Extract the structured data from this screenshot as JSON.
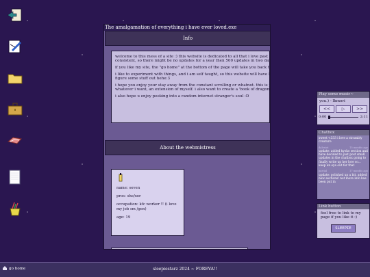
{
  "desktop": {
    "icons": [
      "arrow-scroll-icon",
      "edit-document-icon",
      "folder-icon",
      "briefcase-icon",
      "candy-icon",
      "notepad-icon",
      "paint-bucket-icon"
    ]
  },
  "main_window": {
    "title": "The amalgamation of everything i have ever loved.exe",
    "info_header": "Info",
    "info_paragraphs": [
      "welcome to this mess of a site :) this website is dedicated to all that i love past and present, i'll try to keep it consistent, so there might be no updates for a year then 500 updates in two days :)",
      "if you like my site, the \"go home\" at the bottom of the page will take you back to my homepage",
      "i like to experiment with things, and i am self taught, so this website will have HEAVY personal tweaks as i figure some stuff out hehe:3",
      "i hope you enjoy your stay away from the constant scrolling or whatnot. this is pure self expression, do whatever i want, an extension of myself. i also want to create a 'book of dragons' as i like dragons",
      "i also hope u enjoy peeking into a random internet stranger's soul :D"
    ],
    "about_header": "About the webmistress",
    "profile": {
      "name": "name: seven",
      "pronouns": "pros: she/xer",
      "occupation": "occupation: kfc worker !! (i love my job sm /gen)",
      "age": "age: 19"
    }
  },
  "music_player": {
    "title": "Play some music~",
    "song": "you.) - lkmori",
    "prev_label": "<<",
    "play_label": "▷",
    "next_label": ">>",
    "time_current": "0:00",
    "time_total": "2:11",
    "progress": 0
  },
  "chatbox": {
    "title": "Chatbox",
    "messages": [
      {
        "text": "sweet <333 i love a strumbly creature",
        "author": "",
        "time": ""
      },
      {
        "text": "update: added kyoko section and have decided to just post small updates in the chatbox going to finally write up her lore so... keep an eye out for that",
        "author": "dalesiot",
        "time": "15 months ago"
      },
      {
        "text": "update: polished up a bit, added new sections! not more info has been put in",
        "author": "partial",
        "time": "17 months ago"
      }
    ]
  },
  "link_box": {
    "title": "Link button",
    "text": "feel free to link to my page if you like it :)",
    "button_label": "SLEEPIE"
  },
  "footer": {
    "go_home": "go home",
    "text": "sleepiestarz 2024 ~ FOREVA!!"
  },
  "colors": {
    "background": "#2a1650",
    "window": "#6b5a93",
    "panel": "#c8bfe0",
    "header": "#3e3258"
  }
}
